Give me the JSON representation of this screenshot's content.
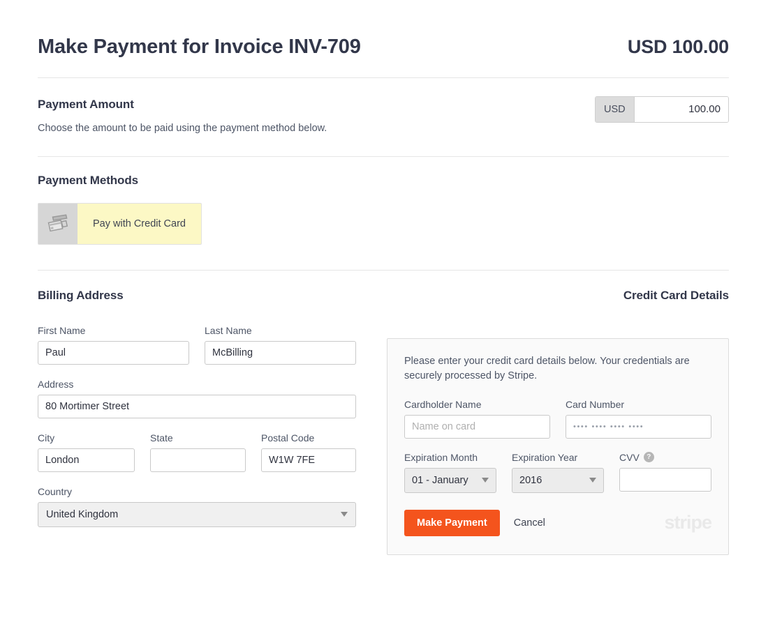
{
  "header": {
    "title": "Make Payment for Invoice INV-709",
    "amount": "USD 100.00"
  },
  "payment_amount": {
    "section_title": "Payment Amount",
    "description": "Choose the amount to be paid using the payment method below.",
    "currency_addon": "USD",
    "value": "100.00"
  },
  "payment_methods": {
    "section_title": "Payment Methods",
    "options": [
      {
        "label": "Pay with Credit Card",
        "icon": "credit-cards-icon",
        "selected": true
      }
    ]
  },
  "billing_address": {
    "section_title": "Billing Address",
    "fields": {
      "first_name": {
        "label": "First Name",
        "value": "Paul"
      },
      "last_name": {
        "label": "Last Name",
        "value": "McBilling"
      },
      "address": {
        "label": "Address",
        "value": "80 Mortimer Street"
      },
      "city": {
        "label": "City",
        "value": "London"
      },
      "state": {
        "label": "State",
        "value": ""
      },
      "postal_code": {
        "label": "Postal Code",
        "value": "W1W 7FE"
      },
      "country": {
        "label": "Country",
        "value": "United Kingdom"
      }
    }
  },
  "credit_card": {
    "section_title": "Credit Card Details",
    "note": "Please enter your credit card details below. Your credentials are securely processed by Stripe.",
    "fields": {
      "cardholder_name": {
        "label": "Cardholder Name",
        "value": "",
        "placeholder": "Name on card"
      },
      "card_number": {
        "label": "Card Number",
        "value": "",
        "placeholder": "•••• •••• •••• ••••"
      },
      "expiration_month": {
        "label": "Expiration Month",
        "value": "01 - January"
      },
      "expiration_year": {
        "label": "Expiration Year",
        "value": "2016"
      },
      "cvv": {
        "label": "CVV",
        "value": "",
        "help_icon": "question-mark-icon"
      }
    },
    "actions": {
      "submit": "Make Payment",
      "cancel": "Cancel"
    },
    "processor_logo": "stripe"
  },
  "colors": {
    "accent": "#f4541d",
    "heading": "#32374a",
    "selected_method_bg": "#fcf8c5"
  }
}
